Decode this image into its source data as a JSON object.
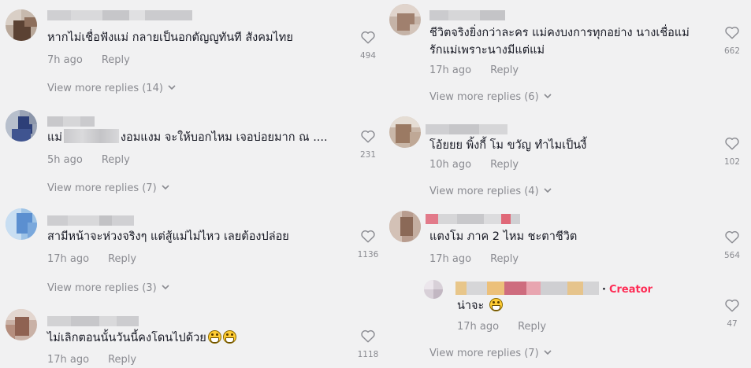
{
  "left_comments": [
    {
      "text": "หากไม่เชื่อฟังแม่ กลายเป็นอกตัญญูทันที สังคมไทย",
      "time": "7h ago",
      "reply": "Reply",
      "likes": "494",
      "view_more": "View more replies (14)"
    },
    {
      "text_before": "แม่",
      "text_after": "งอมแงม จะให้บอกไหม เจอบ่อยมาก ณ ....",
      "time": "5h ago",
      "reply": "Reply",
      "likes": "231",
      "view_more": "View more replies (7)"
    },
    {
      "text": "สามีหน้าจะห่วงจริงๆ แต่สู้แม่ไม่ไหว เลยต้องปล่อย",
      "time": "17h ago",
      "reply": "Reply",
      "likes": "1136",
      "view_more": "View more replies (3)"
    },
    {
      "text": "ไม่เลิกตอนนั้นวันนี้คงโดนไปด้วย",
      "time": "17h ago",
      "reply": "Reply",
      "likes": "1118"
    }
  ],
  "right_comments": [
    {
      "text": "ชีวิตจริงยิ่งกว่าละคร แม่คงบงการทุกอย่าง นางเชื่อแม่รักแม่เพราะนางมีแต่แม่",
      "time": "17h ago",
      "reply": "Reply",
      "likes": "662",
      "view_more": "View more replies (6)"
    },
    {
      "text": "โอ้ยยย พิ้งกี้ โม ขวัญ ทำไมเป็นงี้",
      "time": "10h ago",
      "reply": "Reply",
      "likes": "102",
      "view_more": "View more replies (4)"
    },
    {
      "text": "แตงโม ภาค 2 ไหม ชะตาชีวิต",
      "time": "17h ago",
      "reply": "Reply",
      "likes": "564"
    }
  ],
  "creator_reply": {
    "badge": "Creator",
    "dot": "·",
    "text": "น่าจะ",
    "time": "17h ago",
    "reply": "Reply",
    "likes": "47",
    "view_more": "View more replies (7)"
  },
  "icons": {
    "heart": "heart-outline-icon",
    "chevron": "chevron-down-icon",
    "emoji": "grinning-face-emoji"
  },
  "colors": {
    "background": "#f1f1f2",
    "text": "#161823",
    "muted": "#8a8b91",
    "creator": "#fe2c55"
  }
}
